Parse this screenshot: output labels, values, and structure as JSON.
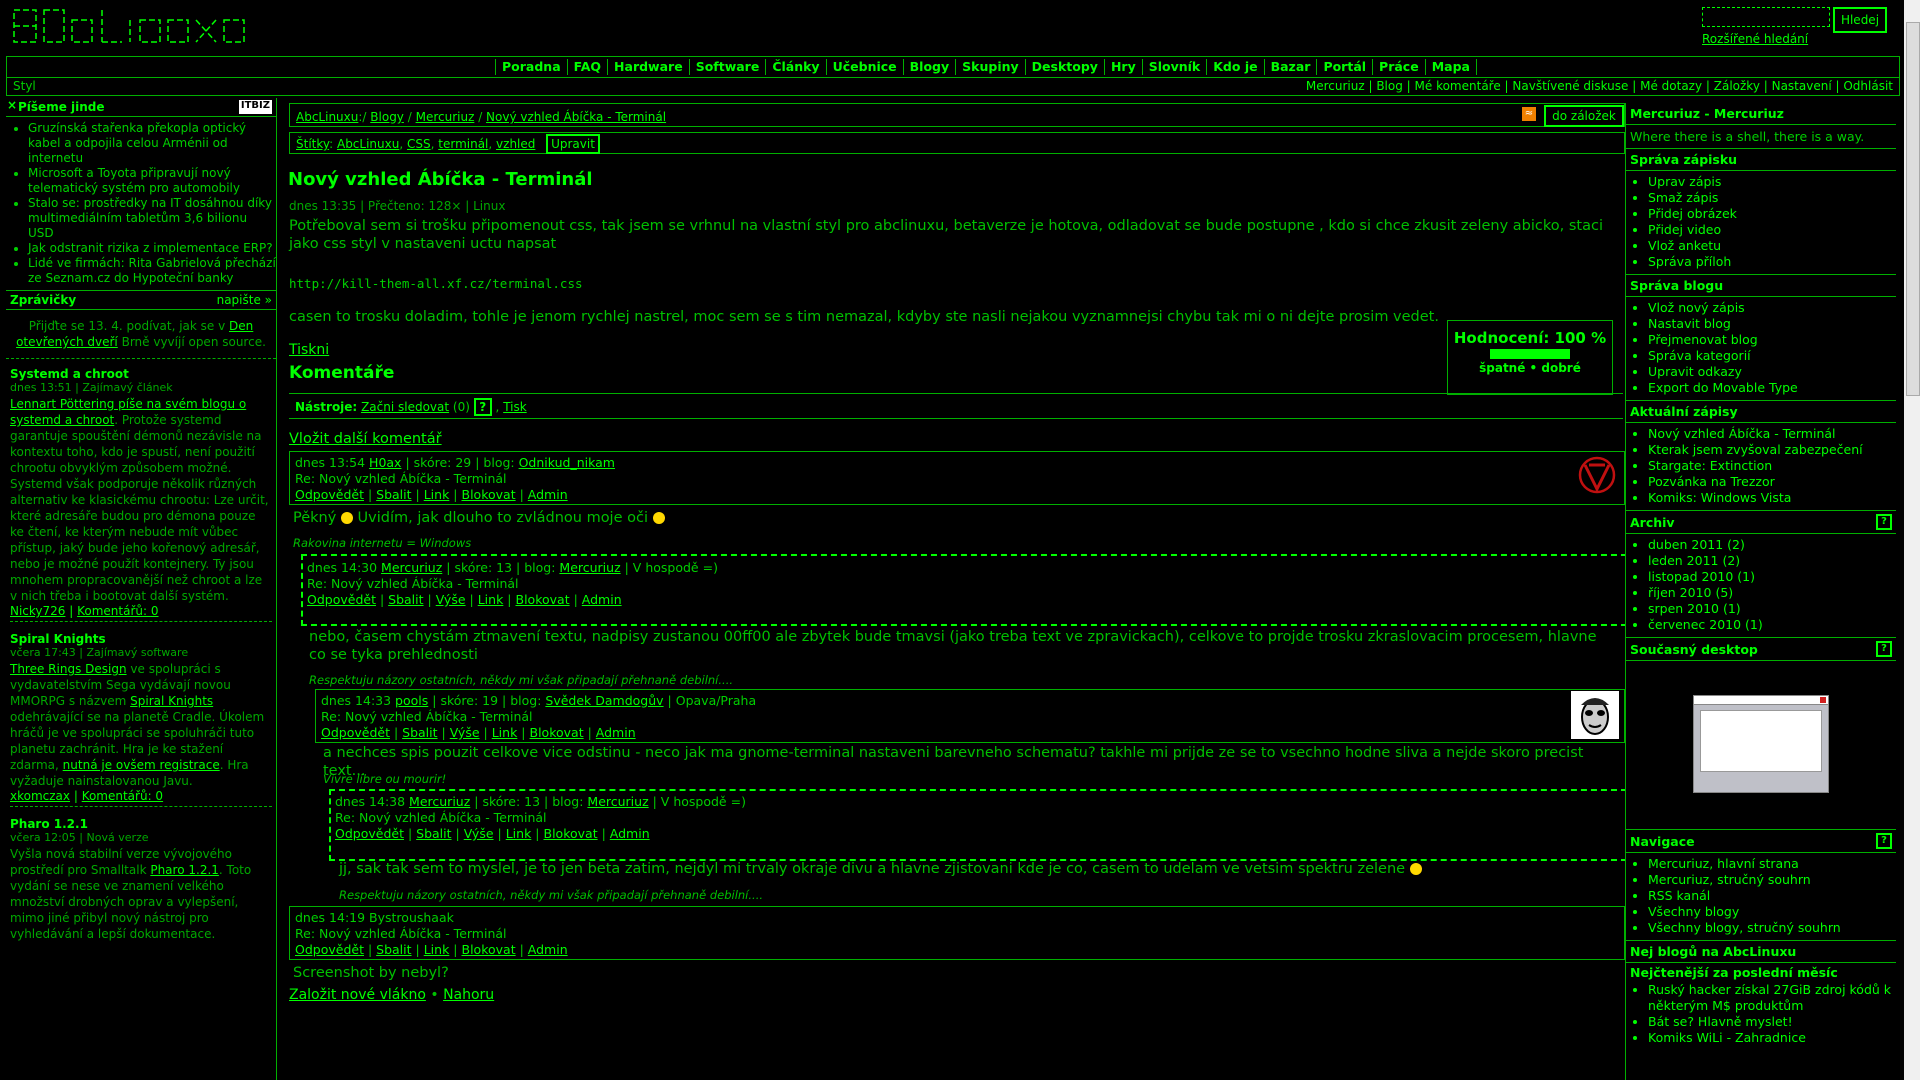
{
  "header": {
    "logo_text": "AbcLinuxu",
    "search_button": "Hledej",
    "advanced_search": "Rozšířené hledání"
  },
  "menu": [
    "Poradna",
    "FAQ",
    "Hardware",
    "Software",
    "Články",
    "Učebnice",
    "Blogy",
    "Skupiny",
    "Desktopy",
    "Hry",
    "Slovník",
    "Kdo je",
    "Bazar",
    "Portál",
    "Práce",
    "Mapa"
  ],
  "toolbar": {
    "style_label": "Styl",
    "user_links": [
      "Mercuriuz",
      "Blog",
      "Mé komentáře",
      "Navštívené diskuse",
      "Mé dotazy",
      "Záložky",
      "Nastavení",
      "Odhlásit"
    ]
  },
  "left": {
    "close": "×",
    "pisemejinde": "Píšeme jinde",
    "itbiz": "ITBIZ",
    "pisemejinde_items": [
      "Gruzínská stařenka překopla optický kabel a odpojila celou Arménii od internetu",
      "Microsoft a Toyota připravují nový telematický systém pro automobily",
      "Stalo se: prostředky na IT dosáhnou díky multimediálním tabletům 3,6 bilionu USD",
      "Jak odstranit rizika z implementace ERP?",
      "Lidé ve firmách: Rita Gabrielová přechází ze Seznam.cz do Hypoteční banky"
    ],
    "zpravicky": "Zprávičky",
    "napiste": "napište »",
    "promo_a": "Přijďte se 13. 4. podívat, jak se v",
    "promo_link": "Den otevřených dveří",
    "promo_b": "Brně vyvíjí open source.",
    "news": [
      {
        "title": "Systemd a chroot",
        "meta": "dnes 13:51 | Zajímavý článek",
        "link1": "Lennart Pöttering píše na svém blogu o systemd a chroot",
        "body": ". Protože systemd garantuje spouštění démonů nezávisle na kontextu toho, kdo je spustí, není použití chrootu obvyklým způsobem možné. Systemd však podporuje několik různých alternativ ke klasickému chrootu: Lze určit, které adresáře budou pro démona pouze ke čtení, ke kterým nebude mít vůbec přístup, jaký bude jeho kořenový adresář, nebo je možné použít kontejnery. Ty jsou mnohem propracovanější než chroot a lze v nich třeba i bootovat další systém.",
        "author": "Nicky726",
        "comments": "Komentářů: 0"
      },
      {
        "title": "Spiral Knights",
        "meta": "včera 17:43 | Zajímavý software",
        "link1": "Three Rings Design",
        "body_a": " ve spolupráci s vydavatelstvím Sega vydávají novou MMORPG s názvem ",
        "link2": "Spiral Knights",
        "body_b": " odehrávající se na planetě Cradle. Úkolem hráčů je ve spolupráci se spoluhráči tuto planetu zachránit. Hra je ke stažení zdarma, ",
        "link3": "nutná je ovšem registrace",
        "body_c": ". Hra vyžaduje nainstalovanou Javu.",
        "author": "xkomczax",
        "comments": "Komentářů: 0"
      },
      {
        "title": "Pharo 1.2.1",
        "meta": "včera 12:05 | Nová verze",
        "body_a": "Vyšla nová stabilní verze vývojového prostředí pro Smalltalk ",
        "link1": "Pharo 1.2.1",
        "body_b": ". Toto vydání se nese ve znamení velkého množství drobných oprav a vylepšení, mimo jiné přibyl nový nástroj pro vyhledávání a lepší dokumentace."
      }
    ]
  },
  "main": {
    "breadcrumbs": [
      "AbcLinuxu",
      "Blogy",
      "Mercuriuz",
      "Nový vzhled Ábíčka - Terminál"
    ],
    "rss": "RSS",
    "bookmark_button": "do záložek",
    "tags_label": "Štítky",
    "tags": [
      "AbcLinuxu",
      "CSS",
      "terminál",
      "vzhled"
    ],
    "edit_button": "Upravit",
    "title": "Nový vzhled Ábíčka - Terminál",
    "meta": "dnes 13:35 | Přečteno: 128× | Linux",
    "para1": "Potřeboval sem si trošku připomenout css, tak jsem se vrhnul na vlastní styl pro abclinuxu, betaverze je hotova, odladovat se bude postupne , kdo si chce zkusit zeleny abicko, staci jako css styl v nastaveni uctu napsat",
    "css_url": "http://kill-them-all.xf.cz/terminal.css",
    "para2": "casen to trosku doladim, tohle je jenom rychlej nastrel, moc sem se s tim nemazal, kdyby ste nasli nejakou vyznamnejsi chybu tak mi o ni dejte prosim vedet.",
    "rating_label": "Hodnocení: 100 %",
    "rating_value": 1.0,
    "rating_scale": "špatné • dobré",
    "print": "Tiskni",
    "comments_heading": "Komentáře",
    "tools_label": "Nástroje:",
    "follow": "Začni sledovat",
    "follow_count": "(0)",
    "help": "?",
    "tisk": "Tisk",
    "add_comment": "Vložit další komentář",
    "comments": [
      {
        "time": "dnes 13:54",
        "author": "H0ax",
        "score": "skóre: 29",
        "blog": "Odnikud_nikam",
        "subject": "Re: Nový vzhled Ábíčka - Terminál",
        "actions": [
          "Odpovědět",
          "Sbalit",
          "Link",
          "Blokovat",
          "Admin"
        ],
        "text_a": "Pěkný ",
        "text_b": " Uvidím, jak dlouho to zvládnou moje oči ",
        "sig": "Rakovina internetu = Windows"
      },
      {
        "time": "dnes 14:30",
        "author": "Mercuriuz",
        "score": "skóre: 13",
        "blog": "Mercuriuz",
        "extra": "| V hospodě =)",
        "subject": "Re: Nový vzhled Ábíčka - Terminál",
        "actions": [
          "Odpovědět",
          "Sbalit",
          "Výše",
          "Link",
          "Blokovat",
          "Admin"
        ],
        "text": "nebo, časem chystám ztmavení textu, nadpisy zustanou 00ff00 ale zbytek bude tmavsi (jako treba text ve zpravickach), celkove to projde trosku zkraslovacim procesem, hlavne co se tyka prehlednosti",
        "sig": "Respektuju názory ostatních, někdy mi však připadají přehnaně debilní...."
      },
      {
        "time": "dnes 14:33",
        "author": "pools",
        "score": "skóre: 19",
        "blog": "Svědek Damdogův",
        "extra": "| Opava/Praha",
        "subject": "Re: Nový vzhled Ábíčka - Terminál",
        "actions": [
          "Odpovědět",
          "Sbalit",
          "Výše",
          "Link",
          "Blokovat",
          "Admin"
        ],
        "text": "a nechces spis pouzit celkove vice odstinu - neco jak ma gnome-terminal nastaveni barevneho schematu? takhle mi prijde ze se to vsechno hodne sliva a nejde skoro precist text...",
        "sig": "Vivre libre ou mourir!"
      },
      {
        "time": "dnes 14:38",
        "author": "Mercuriuz",
        "score": "skóre: 13",
        "blog": "Mercuriuz",
        "extra": "| V hospodě =)",
        "subject": "Re: Nový vzhled Ábíčka - Terminál",
        "actions": [
          "Odpovědět",
          "Sbalit",
          "Výše",
          "Link",
          "Blokovat",
          "Admin"
        ],
        "text": "jj, sak tak sem to myslel, je to jen beta zatim, nejdyl mi trvaly okraje divu a hlavne zjistovani kde je co, casem to udelam ve vetsim spektru zelene ",
        "sig": "Respektuju názory ostatních, někdy mi však připadají přehnaně debilní...."
      },
      {
        "time": "dnes 14:19",
        "author": "Bystroushaak",
        "subject": "Re: Nový vzhled Ábíčka - Terminál",
        "actions": [
          "Odpovědět",
          "Sbalit",
          "Link",
          "Blokovat",
          "Admin"
        ],
        "text": "Screenshot by nebyl?"
      }
    ],
    "footer_a": "Založit nové vlákno",
    "footer_sep": " • ",
    "footer_b": "Nahoru"
  },
  "right": {
    "blog_title": "Mercuriuz - Mercuriuz",
    "motto": "Where there is a shell, there is a way.",
    "sprava_zapisku": "Správa zápisku",
    "sprava_zapisku_items": [
      "Uprav zápis",
      "Smaž zápis",
      "Přidej obrázek",
      "Přidej video",
      "Vlož anketu",
      "Správa příloh"
    ],
    "sprava_blogu": "Správa blogu",
    "sprava_blogu_items": [
      "Vlož nový zápis",
      "Nastavit blog",
      "Přejmenovat blog",
      "Správa kategorií",
      "Upravit odkazy",
      "Export do Movable Type"
    ],
    "aktualni": "Aktuální zápisy",
    "aktualni_items": [
      "Nový vzhled Ábíčka - Terminál",
      "Kterak jsem zvyšoval zabezpečení",
      "Stargate: Extinction",
      "Pozvánka na Trezzor",
      "Komiks: Windows Vista"
    ],
    "archiv": "Archiv",
    "archiv_items": [
      "duben 2011 (2)",
      "leden 2011 (2)",
      "listopad 2010 (1)",
      "říjen 2010 (5)",
      "srpen 2010 (1)",
      "červenec 2010 (1)"
    ],
    "desktop": "Současný desktop",
    "navigace": "Navigace",
    "navigace_items": [
      "Mercuriuz, hlavní strana",
      "Mercuriuz, stručný souhrn",
      "RSS kanál",
      "Všechny blogy",
      "Všechny blogy, stručný souhrn"
    ],
    "nej": "Nej blogů na AbcLinuxu",
    "nej_sub": "Nejčtenější za poslední měsíc",
    "nej_items": [
      "Ruský hacker získal 27GiB zdroj kódů k některým M$ produktům",
      "Bát se? Hlavně myslet!",
      "Komiks WiLi - Zahradnice"
    ],
    "qmark": "?"
  },
  "colors": {
    "background": "#000000",
    "accent": "#00ff00",
    "text": "#00d000",
    "dim": "#00a800"
  }
}
